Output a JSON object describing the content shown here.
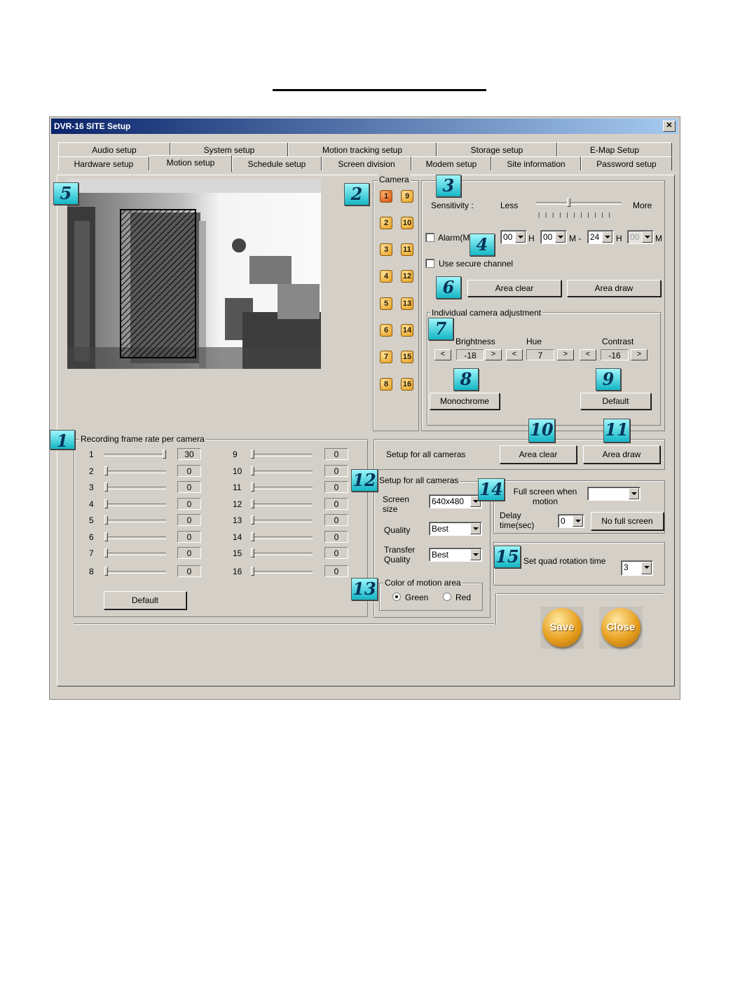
{
  "window": {
    "title": "DVR-16 SITE Setup",
    "close_glyph": "✕"
  },
  "tabs_row1": [
    "Audio setup",
    "System setup",
    "Motion tracking setup",
    "Storage setup",
    "E-Map Setup"
  ],
  "tabs_row2": [
    "Hardware setup",
    "Motion setup",
    "Schedule setup",
    "Screen division",
    "Modem setup",
    "Site information",
    "Password setup"
  ],
  "active_tab": "Motion setup",
  "callouts": [
    "1",
    "2",
    "3",
    "4",
    "5",
    "6",
    "7",
    "8",
    "9",
    "10",
    "11",
    "12",
    "13",
    "14",
    "15"
  ],
  "camera_group": {
    "label": "Camera",
    "selected": "1",
    "left_col": [
      "1",
      "2",
      "3",
      "4",
      "5",
      "6",
      "7",
      "8"
    ],
    "right_col": [
      "9",
      "10",
      "11",
      "12",
      "13",
      "14",
      "15",
      "16"
    ]
  },
  "sensitivity": {
    "label": "Sensitivity :",
    "less": "Less",
    "more": "More",
    "level_fraction": 0.38
  },
  "alarm": {
    "label": "Alarm(M",
    "start_h": "00",
    "h1": "H",
    "start_m": "00",
    "m1": "M -",
    "end_h": "24",
    "h2": "H",
    "end_m": "00",
    "m2": "M",
    "checked": false
  },
  "secure": {
    "label": "Use secure channel",
    "checked": false
  },
  "area_buttons": {
    "clear": "Area clear",
    "draw": "Area draw"
  },
  "adjust": {
    "label": "Individual camera adjustment",
    "brightness": {
      "label": "Brightness",
      "value": "-18"
    },
    "hue": {
      "label": "Hue",
      "value": "7"
    },
    "contrast": {
      "label": "Contrast",
      "value": "-16"
    },
    "left_arrow": "<",
    "right_arrow": ">",
    "monochrome": "Monochrome",
    "default": "Default"
  },
  "frame_rate": {
    "label": "Recording frame rate per camera",
    "left": [
      {
        "cam": "1",
        "value": "30",
        "fill": 1.0
      },
      {
        "cam": "2",
        "value": "0",
        "fill": 0
      },
      {
        "cam": "3",
        "value": "0",
        "fill": 0
      },
      {
        "cam": "4",
        "value": "0",
        "fill": 0
      },
      {
        "cam": "5",
        "value": "0",
        "fill": 0
      },
      {
        "cam": "6",
        "value": "0",
        "fill": 0
      },
      {
        "cam": "7",
        "value": "0",
        "fill": 0
      },
      {
        "cam": "8",
        "value": "0",
        "fill": 0
      }
    ],
    "right": [
      {
        "cam": "9",
        "value": "0",
        "fill": 0
      },
      {
        "cam": "10",
        "value": "0",
        "fill": 0
      },
      {
        "cam": "11",
        "value": "0",
        "fill": 0
      },
      {
        "cam": "12",
        "value": "0",
        "fill": 0
      },
      {
        "cam": "13",
        "value": "0",
        "fill": 0
      },
      {
        "cam": "14",
        "value": "0",
        "fill": 0
      },
      {
        "cam": "15",
        "value": "0",
        "fill": 0
      },
      {
        "cam": "16",
        "value": "0",
        "fill": 0
      }
    ],
    "default": "Default"
  },
  "all_cameras_area": {
    "label": "Setup for all cameras",
    "clear": "Area clear",
    "draw": "Area draw"
  },
  "all_cameras": {
    "label": "Setup for all cameras",
    "screen_size_label": "Screen size",
    "screen_size": "640x480",
    "quality_label": "Quality",
    "quality": "Best",
    "transfer_label": "Transfer Quality",
    "transfer": "Best"
  },
  "motion_color": {
    "label": "Color of motion area",
    "green": "Green",
    "red": "Red",
    "selected": "Green"
  },
  "fullscreen": {
    "label": "Full screen when motion",
    "value": "",
    "delay_label": "Delay time(sec)",
    "delay": "0",
    "no_full": "No full screen"
  },
  "quad": {
    "label": "Set quad rotation time",
    "value": "3"
  },
  "actions": {
    "save": "Save",
    "close": "Close"
  }
}
